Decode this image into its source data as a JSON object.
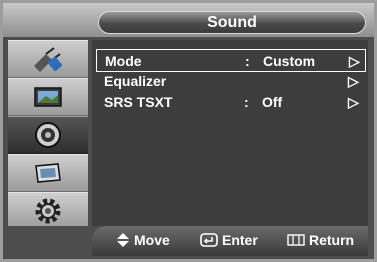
{
  "header": {
    "title": "Sound"
  },
  "sidebar": {
    "items": [
      {
        "icon": "antenna-plug-icon"
      },
      {
        "icon": "picture-screen-icon"
      },
      {
        "icon": "speaker-icon",
        "active": true
      },
      {
        "icon": "channel-tv-icon"
      },
      {
        "icon": "gear-setup-icon"
      }
    ]
  },
  "menu": {
    "rows": [
      {
        "label": "Mode",
        "colon": ":",
        "value": "Custom",
        "arrow": "▷"
      },
      {
        "label": "Equalizer",
        "colon": "",
        "value": "",
        "arrow": "▷"
      },
      {
        "label": "SRS TSXT",
        "colon": ":",
        "value": "Off",
        "arrow": "▷"
      }
    ]
  },
  "footer": {
    "move_label": "Move",
    "enter_label": "Enter",
    "return_label": "Return"
  },
  "colors": {
    "accent": "#ffffff",
    "panel": "#3d3d3d",
    "frame": "#4d4d4d"
  }
}
